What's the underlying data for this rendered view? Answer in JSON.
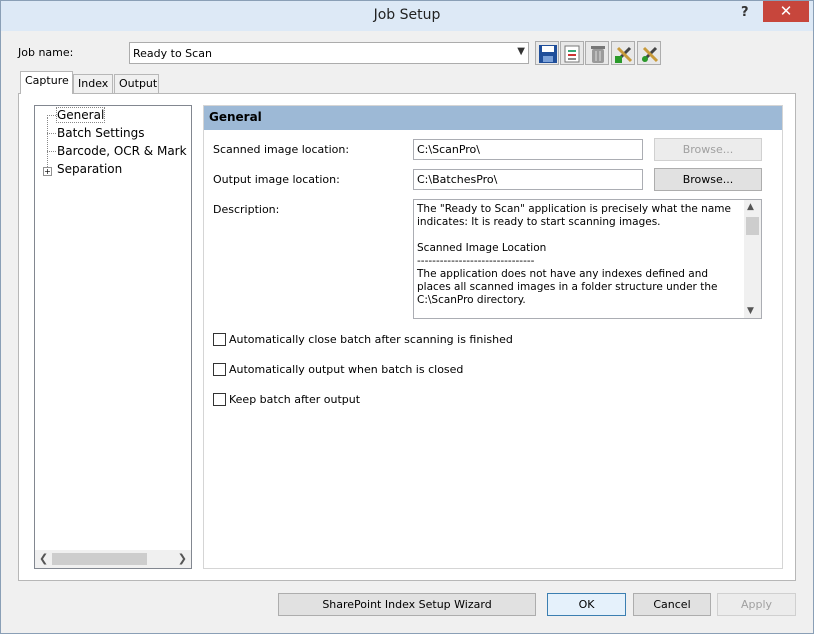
{
  "window": {
    "title": "Job Setup",
    "help_label": "?",
    "close_label": "✕"
  },
  "job": {
    "label": "Job name:",
    "value": "Ready to Scan",
    "dropdown_arrow": "chevron-down-icon"
  },
  "toolbar": {
    "icons": [
      "save-icon",
      "properties-icon",
      "delete-icon",
      "tools-add-icon",
      "tools-edit-icon"
    ]
  },
  "tabs": [
    {
      "label": "Capture",
      "active": true
    },
    {
      "label": "Index",
      "active": false
    },
    {
      "label": "Output",
      "active": false
    }
  ],
  "tree": {
    "items": [
      {
        "label": "General",
        "selected": true
      },
      {
        "label": "Batch Settings"
      },
      {
        "label": "Barcode, OCR & Mark De"
      },
      {
        "label": "Separation",
        "expander": "+"
      }
    ]
  },
  "section": {
    "header": "General",
    "scanned_label": "Scanned image location:",
    "scanned_value": "C:\\ScanPro\\",
    "browse_scanned": "Browse...",
    "output_label": "Output image location:",
    "output_value": "C:\\BatchesPro\\",
    "browse_output": "Browse...",
    "description_label": "Description:",
    "description": "The \"Ready to Scan\" application is precisely what the name indicates: It is ready to start scanning images.\n\nScanned Image Location\n-------------------------------\nThe application does not have any indexes defined and places all scanned images in a folder structure under the C:\\ScanPro directory."
  },
  "options": [
    {
      "label": "Automatically close batch after scanning is finished",
      "checked": false
    },
    {
      "label": "Automatically output when batch is closed",
      "checked": false
    },
    {
      "label": "Keep batch after output",
      "checked": false
    }
  ],
  "buttons": {
    "sharepoint": "SharePoint Index Setup Wizard",
    "ok": "OK",
    "cancel": "Cancel",
    "apply": "Apply"
  }
}
